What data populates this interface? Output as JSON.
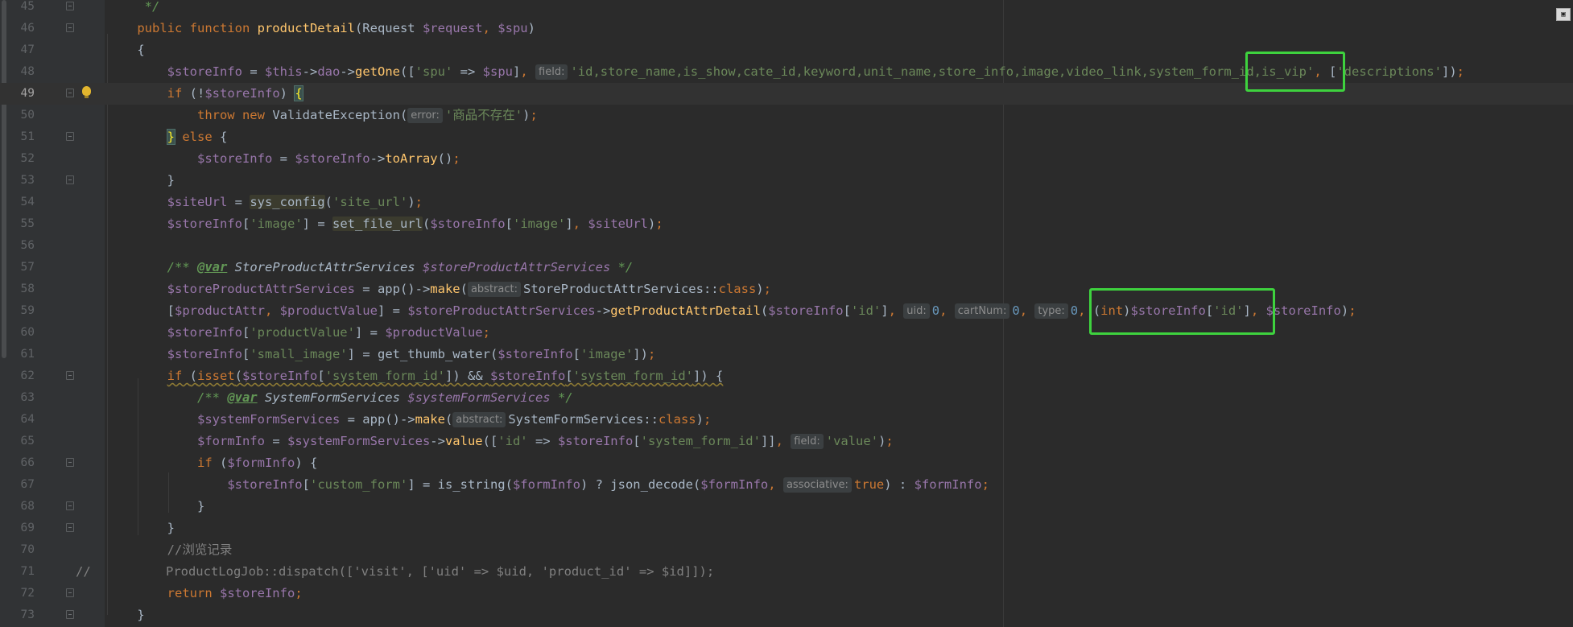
{
  "editor": {
    "line_numbers": [
      "45",
      "46",
      "47",
      "48",
      "49",
      "50",
      "51",
      "52",
      "53",
      "54",
      "55",
      "56",
      "57",
      "58",
      "59",
      "60",
      "61",
      "62",
      "63",
      "64",
      "65",
      "66",
      "67",
      "68",
      "69",
      "70",
      "71",
      "72",
      "73"
    ],
    "current_line": "49",
    "hints": {
      "field": "field:",
      "error": "error:",
      "abstract": "abstract:",
      "uid": "uid:",
      "cartNum": "cartNum:",
      "type": "type:",
      "associative": "associative:"
    },
    "highlights": [
      {
        "line": "48",
        "text": "id,is_vip', ["
      },
      {
        "line": "59",
        "text": "(int)$storeInfo['id'],"
      }
    ],
    "corner_icon": "presentation-icon"
  }
}
